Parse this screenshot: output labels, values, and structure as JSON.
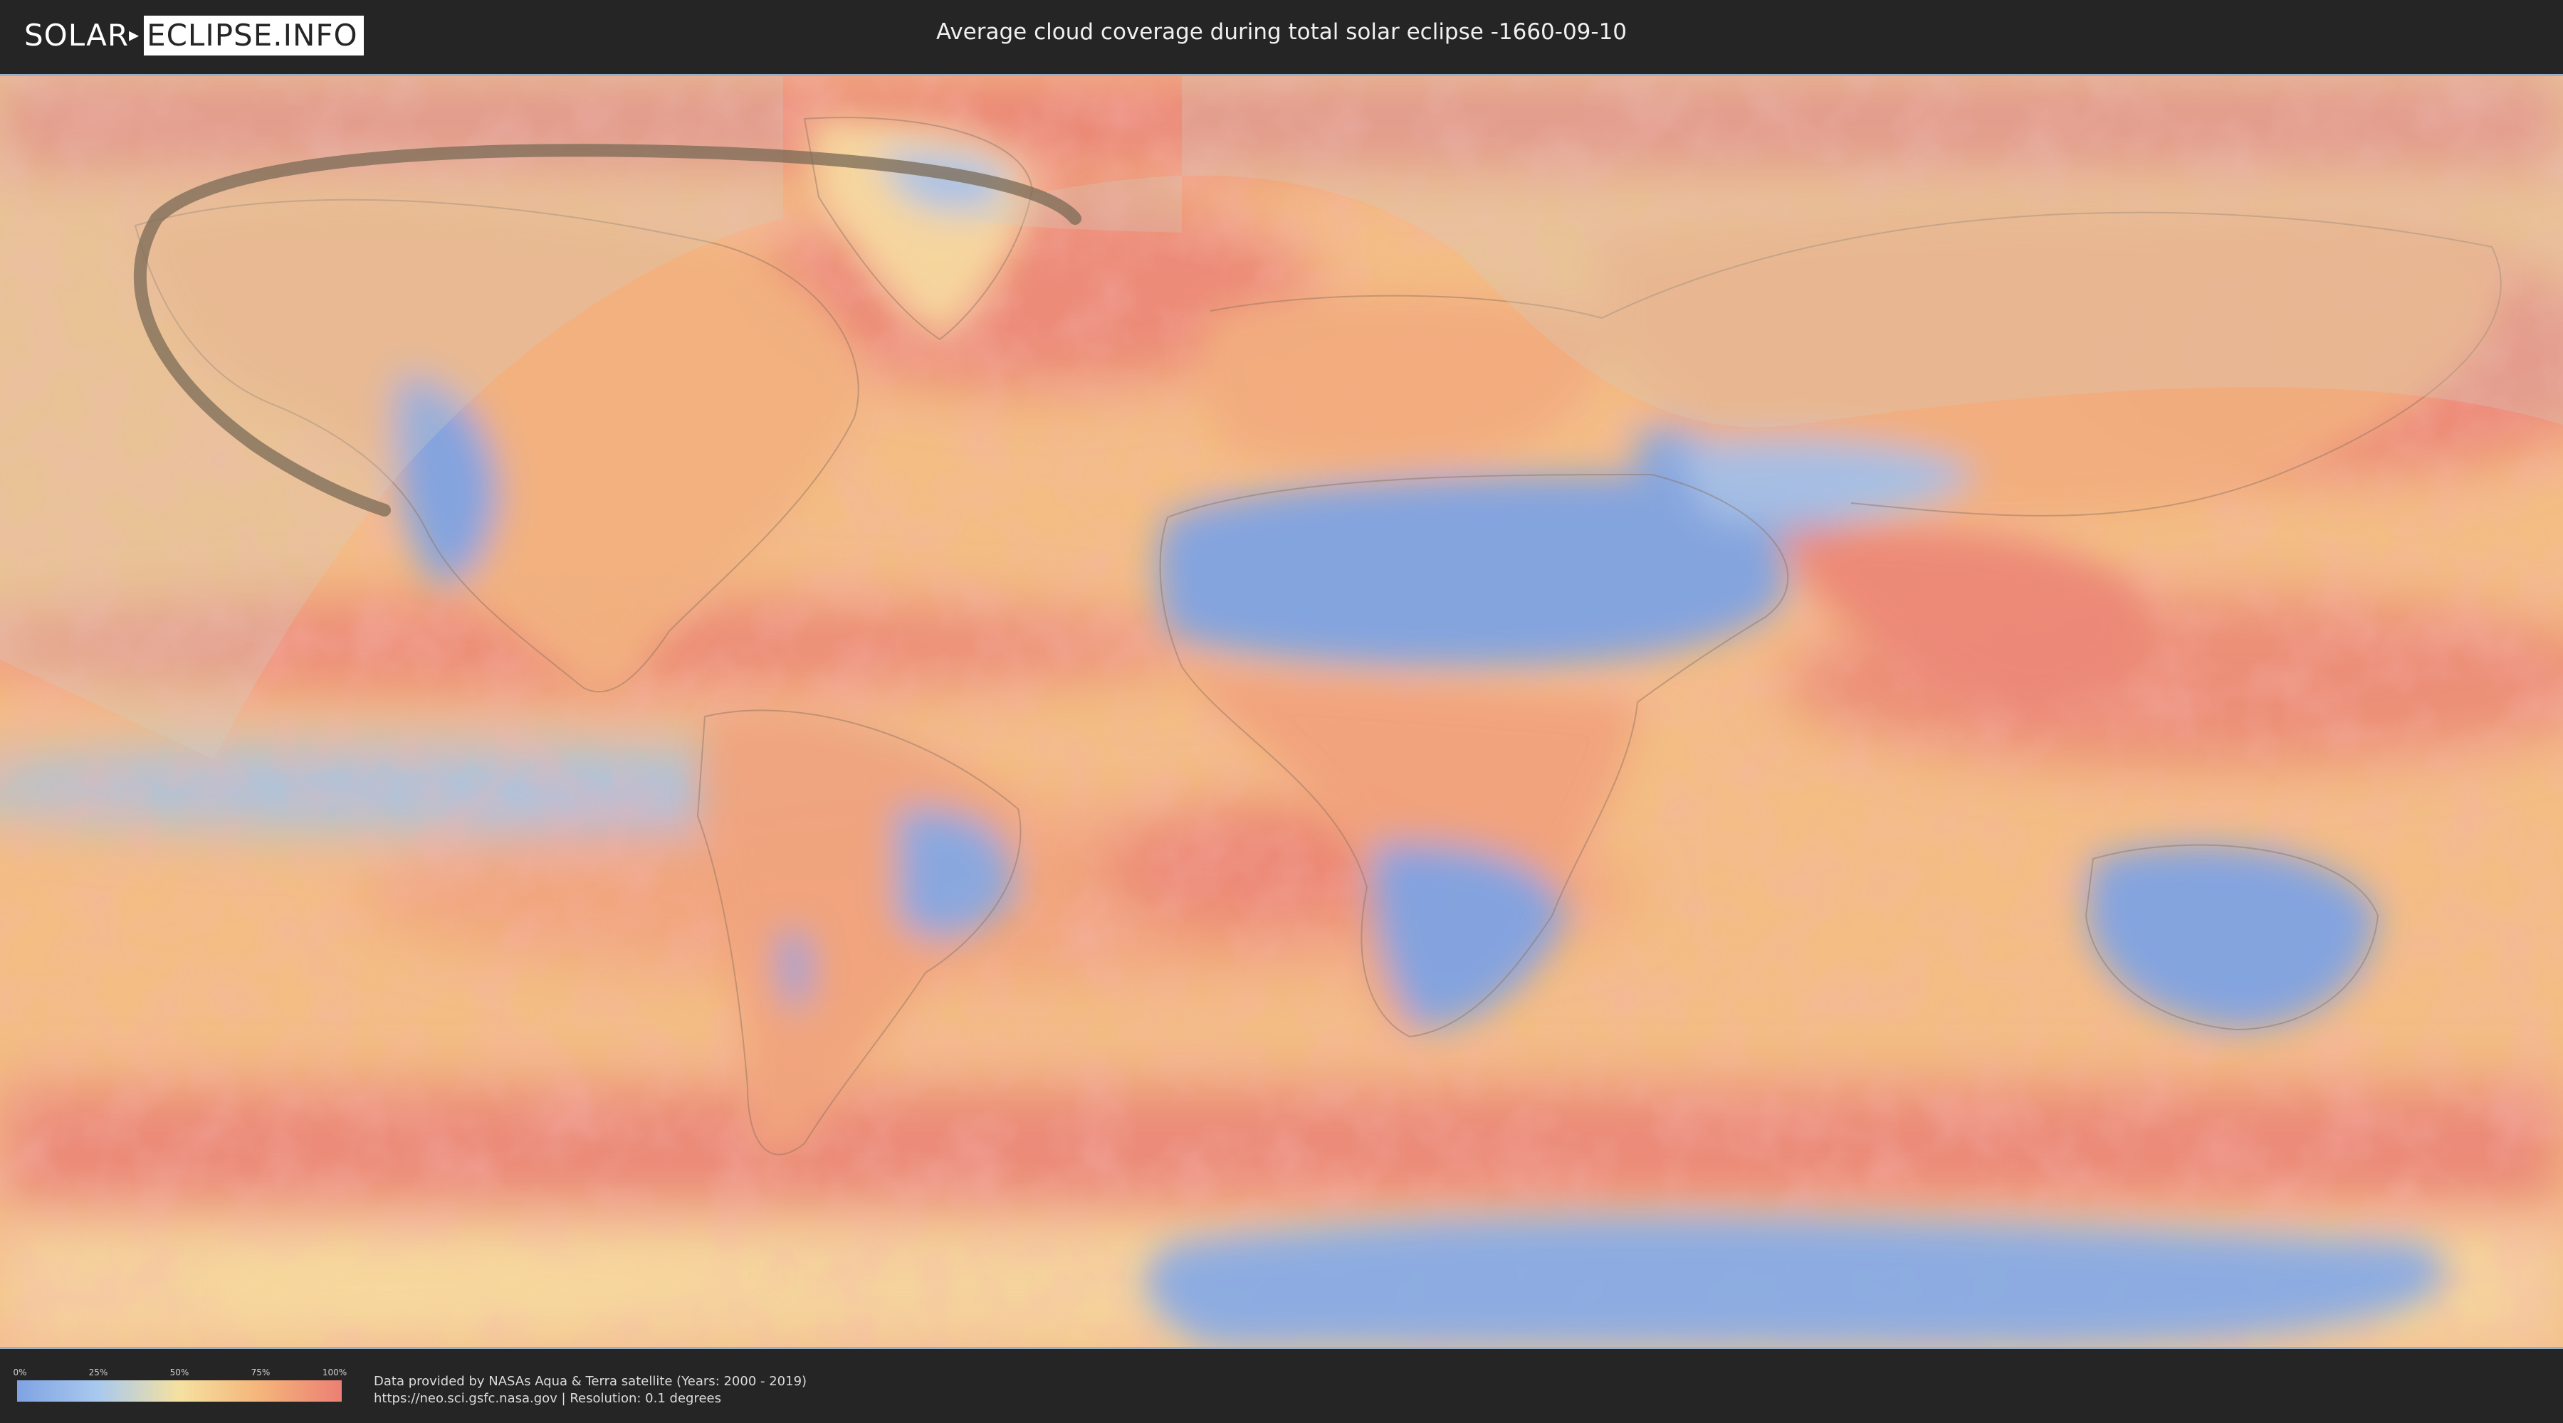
{
  "logo": {
    "part1": "SOLAR",
    "part2": "ECLIPSE.INFO"
  },
  "title": "Average cloud coverage during total solar eclipse -1660-09-10",
  "map": {
    "colors": {
      "ocean_base": "#f2b880",
      "high_cloud": "#ec7f74",
      "low_cloud": "#7fa3e3",
      "mid_cloud": "#f5e1a0",
      "eclipse_path": "#7a6a55",
      "daylight_overlay": "#d8d2b4"
    }
  },
  "legend": {
    "ticks": [
      "0%",
      "25%",
      "50%",
      "75%",
      "100%"
    ]
  },
  "credits": {
    "line1": "Data provided by NASAs Aqua & Terra satellite (Years: 2000 - 2019)",
    "line2": "https://neo.sci.gsfc.nasa.gov | Resolution: 0.1 degrees"
  }
}
